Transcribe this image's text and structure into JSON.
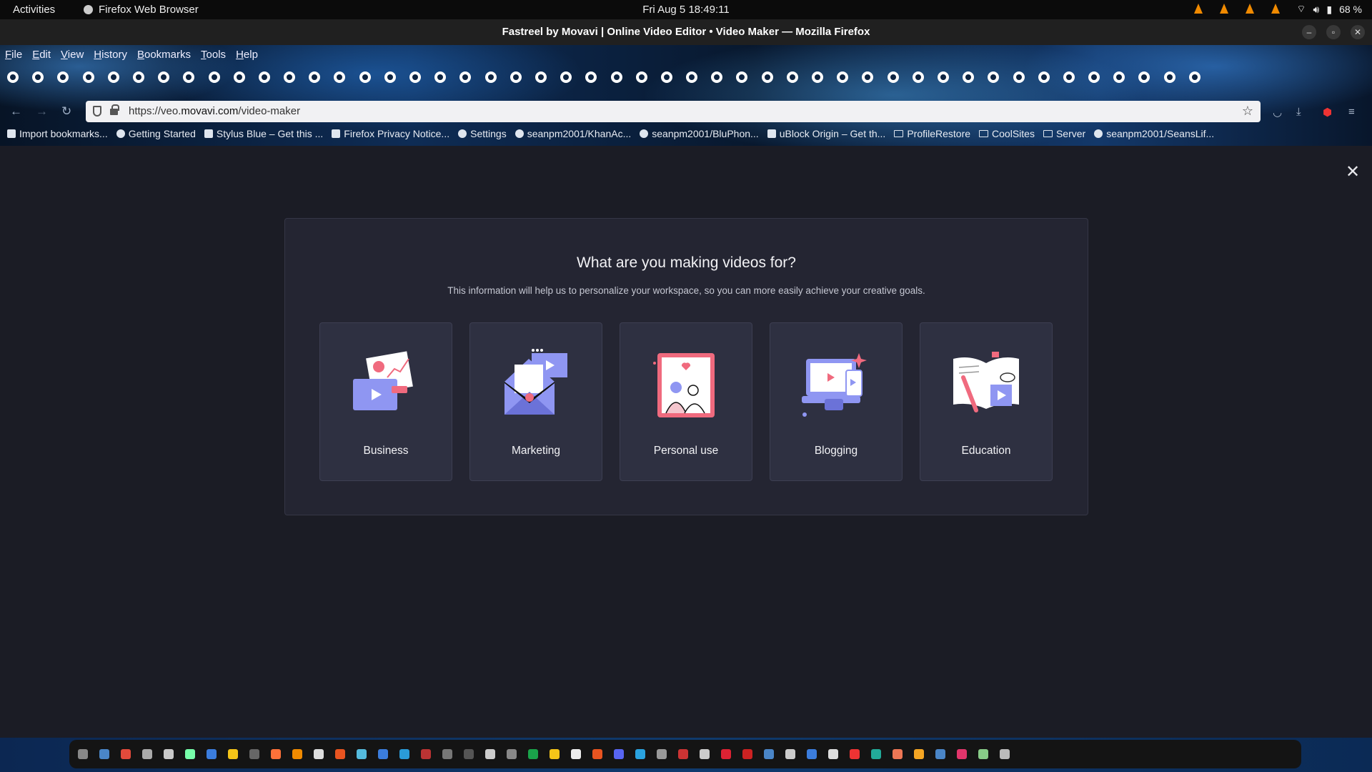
{
  "system": {
    "activities": "Activities",
    "app_name": "Firefox Web Browser",
    "clock": "Fri Aug 5  18:49:11",
    "battery": "68 %"
  },
  "window": {
    "title": "Fastreel by Movavi | Online Video Editor • Video Maker — Mozilla Firefox"
  },
  "menubar": [
    "File",
    "Edit",
    "View",
    "History",
    "Bookmarks",
    "Tools",
    "Help"
  ],
  "url": {
    "prefix": "https://veo.",
    "domain": "movavi.com",
    "path": "/video-maker"
  },
  "bookmarks": [
    {
      "label": "Import bookmarks...",
      "icon": "import-icon"
    },
    {
      "label": "Getting Started",
      "icon": "firefox-icon"
    },
    {
      "label": "Stylus Blue – Get this ...",
      "icon": "stylus-icon"
    },
    {
      "label": "Firefox Privacy Notice...",
      "icon": "medium-icon"
    },
    {
      "label": "Settings",
      "icon": "gear-icon"
    },
    {
      "label": "seanpm2001/KhanAc...",
      "icon": "github-icon"
    },
    {
      "label": "seanpm2001/BluPhon...",
      "icon": "github-icon"
    },
    {
      "label": "uBlock Origin – Get th...",
      "icon": "ublock-icon"
    },
    {
      "label": "ProfileRestore",
      "icon": "folder-icon"
    },
    {
      "label": "CoolSites",
      "icon": "folder-icon"
    },
    {
      "label": "Server",
      "icon": "folder-icon"
    },
    {
      "label": "seanpm2001/SeansLif...",
      "icon": "github-icon"
    }
  ],
  "modal": {
    "heading": "What are you making videos for?",
    "subtext": "This information will help us to personalize your workspace, so you can more easily achieve your creative goals.",
    "options": [
      {
        "label": "Business",
        "icon": "business-illustration"
      },
      {
        "label": "Marketing",
        "icon": "marketing-illustration"
      },
      {
        "label": "Personal use",
        "icon": "personal-use-illustration"
      },
      {
        "label": "Blogging",
        "icon": "blogging-illustration"
      },
      {
        "label": "Education",
        "icon": "education-illustration"
      }
    ]
  },
  "colors": {
    "page_bg": "#1b1c25",
    "modal_bg": "#242532",
    "card_bg": "#2e3041",
    "accent_purple": "#8f96f2",
    "accent_pink": "#f06a7e"
  }
}
